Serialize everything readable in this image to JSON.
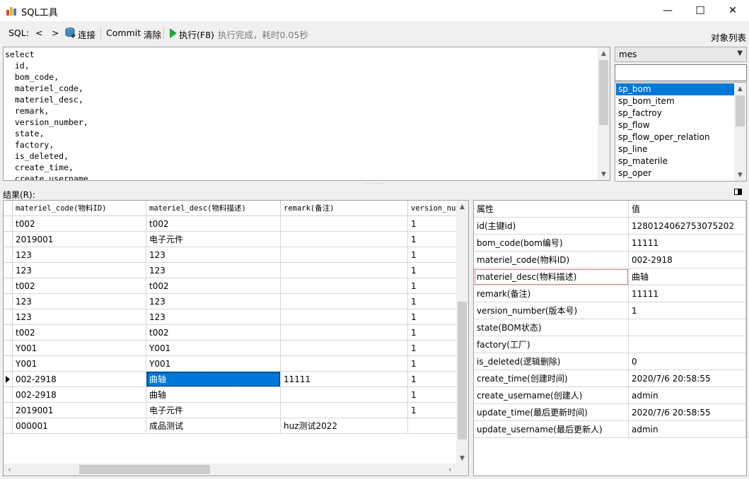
{
  "window": {
    "title": "SQL工具",
    "minimize": "—",
    "maximize": "☐",
    "close": "✕"
  },
  "toolbar": {
    "sql_label": "SQL:",
    "prev": "<",
    "next": ">",
    "connect": "连接",
    "commit": "Commit",
    "clear": "清除",
    "execute": "执行(F8)",
    "status": "执行完成，耗时0.05秒",
    "object_list": "对象列表"
  },
  "editor": {
    "sql": "select\n  id,\n  bom_code,\n  materiel_code,\n  materiel_desc,\n  remark,\n  version_number,\n  state,\n  factory,\n  is_deleted,\n  create_time,\n  create_username,"
  },
  "objects": {
    "database": "mes",
    "filter": "",
    "items": [
      "sp_bom",
      "sp_bom_item",
      "sp_factroy",
      "sp_flow",
      "sp_flow_oper_relation",
      "sp_line",
      "sp_materile",
      "sp_oper"
    ],
    "selected_index": 0
  },
  "result": {
    "label": "结果(R):",
    "columns": [
      "materiel_code(物料ID)",
      "materiel_desc(物料描述)",
      "remark(备注)",
      "version_num"
    ],
    "rows": [
      [
        "t002",
        "t002",
        "",
        "1"
      ],
      [
        "2019001",
        "电子元件",
        "",
        "1"
      ],
      [
        "123",
        "123",
        "",
        "1"
      ],
      [
        "123",
        "123",
        "",
        "1"
      ],
      [
        "t002",
        "t002",
        "",
        "1"
      ],
      [
        "123",
        "123",
        "",
        "1"
      ],
      [
        "123",
        "123",
        "",
        "1"
      ],
      [
        "t002",
        "t002",
        "",
        "1"
      ],
      [
        "Y001",
        "Y001",
        "",
        "1"
      ],
      [
        "Y001",
        "Y001",
        "",
        "1"
      ],
      [
        "002-2918",
        "曲轴",
        "11111",
        "1"
      ],
      [
        "002-2918",
        "曲轴",
        "",
        "1"
      ],
      [
        "2019001",
        "电子元件",
        "",
        "1"
      ],
      [
        "000001",
        "成品测试",
        "huz测试2022",
        ""
      ]
    ],
    "current_row": 10,
    "selected_col": 1
  },
  "properties": {
    "header_name": "属性",
    "header_value": "值",
    "rows": [
      {
        "name": "id(主键id)",
        "value": "1280124062753075202"
      },
      {
        "name": "bom_code(bom编号)",
        "value": "11111"
      },
      {
        "name": "materiel_code(物料ID)",
        "value": "002-2918"
      },
      {
        "name": "materiel_desc(物料描述)",
        "value": "曲轴"
      },
      {
        "name": "remark(备注)",
        "value": "11111"
      },
      {
        "name": "version_number(版本号)",
        "value": "1"
      },
      {
        "name": "state(BOM状态)",
        "value": ""
      },
      {
        "name": "factory(工厂)",
        "value": ""
      },
      {
        "name": "is_deleted(逻辑删除)",
        "value": "0"
      },
      {
        "name": "create_time(创建时间)",
        "value": "2020/7/6 20:58:55"
      },
      {
        "name": "create_username(创建人)",
        "value": "admin"
      },
      {
        "name": "update_time(最后更新时间)",
        "value": "2020/7/6 20:58:55"
      },
      {
        "name": "update_username(最后更新人)",
        "value": "admin"
      }
    ],
    "focused_index": 3
  },
  "colors": {
    "selection": "#0078d7",
    "execute_icon": "#1aa832"
  }
}
